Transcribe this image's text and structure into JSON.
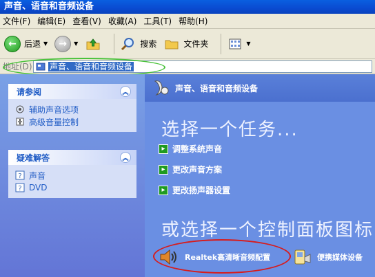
{
  "window": {
    "title": "声音、语音和音频设备"
  },
  "menu": [
    "文件(F)",
    "编辑(E)",
    "查看(V)",
    "收藏(A)",
    "工具(T)",
    "帮助(H)"
  ],
  "toolbar": {
    "back_label": "后退",
    "search_label": "搜索",
    "folders_label": "文件夹"
  },
  "address": {
    "label": "地址(D)",
    "value": "声音、语音和音频设备"
  },
  "see_also": {
    "title": "请参阅",
    "items": [
      "辅助声音选项",
      "高级音量控制"
    ]
  },
  "troubleshoot": {
    "title": "疑难解答",
    "items": [
      "声音",
      "DVD"
    ]
  },
  "content": {
    "category_title": "声音、语音和音频设备",
    "pick_task": "选择一个任务...",
    "tasks": [
      "调整系统声音",
      "更改声音方案",
      "更改扬声器设置"
    ],
    "or_pick": "或选择一个控制面板图标",
    "cp_items": [
      "Realtek高清晰音频配置",
      "便携媒体设备"
    ]
  },
  "colors": {
    "title_bar": "#0a4bd1",
    "task_pane": "#6375d6",
    "link": "#215dc6",
    "highlight_red": "#d81b1b",
    "highlight_green": "#49c23a"
  }
}
